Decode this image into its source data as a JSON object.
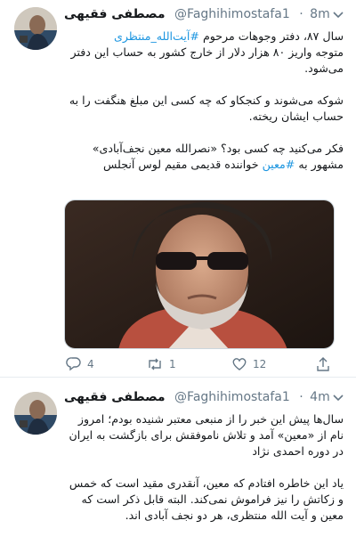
{
  "tweets": [
    {
      "author": {
        "name": "مصطفی فقیهی",
        "handle": "@Faghihimostafa1",
        "time": "8m"
      },
      "text": {
        "line1": "سال ۸۷، دفتر وجوهات مرحوم ",
        "hashtag1": "#آیت‌الله_منتظری",
        "line2": "\nمتوجه واریز ۸۰ هزار دلار از خارج کشور به حساب این دفتر می‌شود.\n\nشوکه می‌شوند و کنجکاو که چه کسی این مبلغ هنگفت را به حساب ایشان ریخته.\n\nفکر می‌کنید چه کسی بود؟ «نصرالله معین نجف‌آبادی» مشهور به ",
        "hashtag2": "#معین",
        "line3": " خواننده قدیمی مقیم لوس آنجلس"
      },
      "counts": {
        "replies": "4",
        "retweets": "1",
        "likes": "12"
      }
    },
    {
      "author": {
        "name": "مصطفی فقیهی",
        "handle": "@Faghihimostafa1",
        "time": "4m"
      },
      "text": "سال‌ها پیش این خبر را از منبعی معتبر شنیده بودم؛ امروز نام از «معین» آمد و تلاش ناموفقش برای بازگشت به ایران در دوره احمدی نژاد\n\nیاد این خاطره افتادم که معین، آنقدری مقید است که خمس و زکاتش را نیز فراموش نمی‌کند. البته قابل ذکر است که معین و آیت الله منتظری، هر دو نجف آبادی اند."
    }
  ],
  "icons": {
    "reply": "reply-icon",
    "retweet": "retweet-icon",
    "like": "heart-icon",
    "share": "share-icon",
    "more": "chevron-down-icon"
  },
  "colors": {
    "link": "#1b95e0",
    "secondary": "#657786",
    "divider": "#e6ecf0"
  }
}
